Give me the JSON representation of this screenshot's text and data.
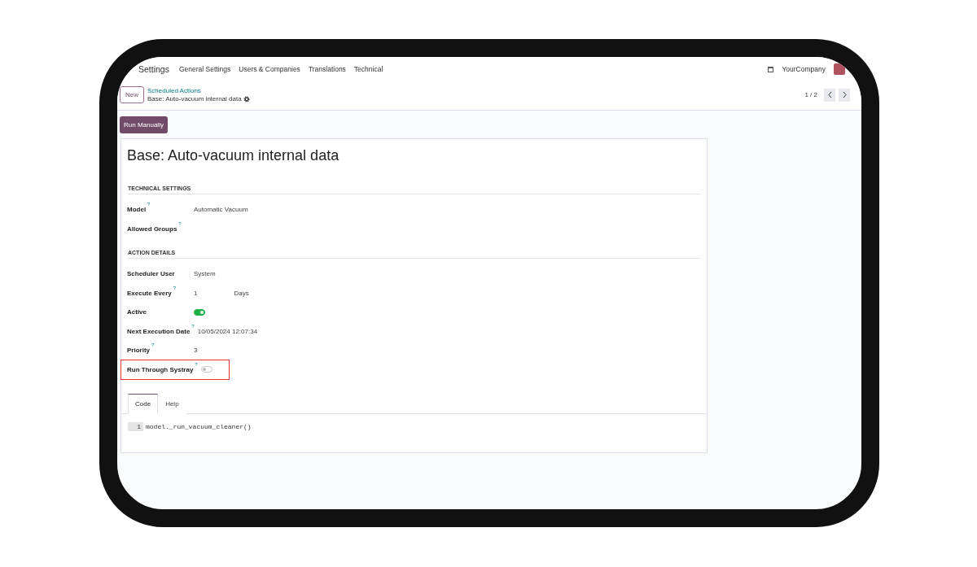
{
  "navbar": {
    "app": "Settings",
    "menu": [
      "General Settings",
      "Users & Companies",
      "Translations",
      "Technical"
    ],
    "company": "YourCompany"
  },
  "control_panel": {
    "new_button": "New",
    "breadcrumb": "Scheduled Actions",
    "record": "Base: Auto-vacuum internal data",
    "pager": "1 / 2"
  },
  "action_button": "Run Manually",
  "form": {
    "title": "Base: Auto-vacuum internal data",
    "sections": [
      {
        "heading": "TECHNICAL SETTINGS",
        "fields": [
          {
            "kind": "text",
            "label": "Model",
            "help_mark": "?",
            "value": "Automatic Vacuum",
            "highlighted": false
          },
          {
            "kind": "text",
            "label": "Allowed Groups",
            "help_mark": "?",
            "highlighted": false
          }
        ]
      },
      {
        "heading": "ACTION DETAILS",
        "fields": [
          {
            "kind": "text",
            "label": "Scheduler User",
            "value": "System",
            "highlighted": false
          },
          {
            "kind": "interval",
            "label": "Execute Every",
            "help_mark": "?",
            "value": "1",
            "unit": "Days",
            "highlighted": false
          },
          {
            "kind": "toggle",
            "label": "Active",
            "on": true,
            "highlighted": false
          },
          {
            "kind": "text",
            "label": "Next Execution Date",
            "help_mark": "?",
            "value": "10/05/2024 12:07:34",
            "highlighted": false
          },
          {
            "kind": "text",
            "label": "Priority",
            "help_mark": "?",
            "value": "3",
            "highlighted": false
          },
          {
            "kind": "toggle",
            "label": "Run Through Systray",
            "help_mark": "?",
            "on": false,
            "highlighted": true
          }
        ]
      }
    ],
    "tabs": [
      {
        "label": "Code",
        "selected": true
      },
      {
        "label": "Help",
        "selected": false
      }
    ],
    "code": {
      "line_number": "1",
      "text": "model._run_vacuum_cleaner()"
    }
  }
}
